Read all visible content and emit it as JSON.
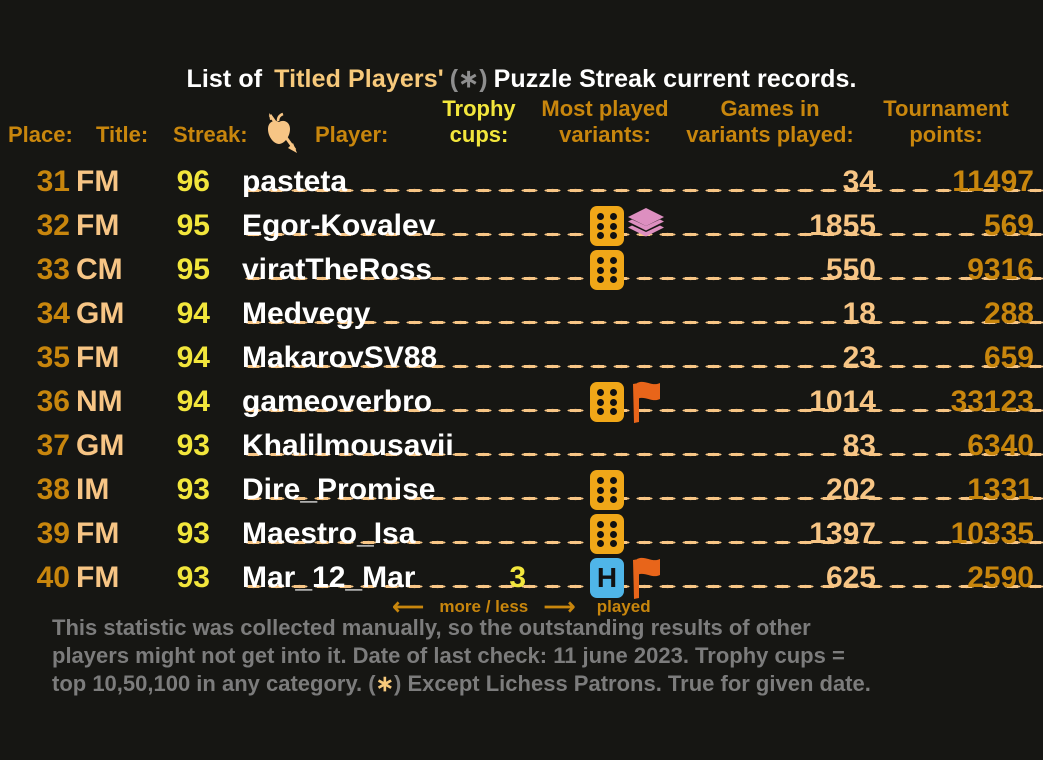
{
  "title": {
    "part1": "List of",
    "part2": "Titled Players'",
    "asterisk": "(∗)",
    "part3": "Puzzle Streak current records."
  },
  "headers": {
    "place": "Place:",
    "title": "Title:",
    "streak": "Streak:",
    "streak_icon": "apple-arrow-icon",
    "player": "Player:",
    "trophy_l1": "Trophy",
    "trophy_l2": "cups:",
    "most_l1": "Most played",
    "most_l2": "variants:",
    "games_l1": "Games in",
    "games_l2": "variants played:",
    "tourn_l1": "Tournament",
    "tourn_l2": "points:"
  },
  "colors": {
    "background": "#161613",
    "place": "#C8860D",
    "title_col": "#F7C585",
    "streak": "#F2E63C",
    "player": "#FFFFFF",
    "games": "#F7C585",
    "tournament": "#C8860D",
    "footer": "#7C7C7C",
    "die": "#F0A718",
    "layers": "#DD8FC0",
    "flag": "#E8651A",
    "horde": "#4FB5E8"
  },
  "rows": [
    {
      "place": "31",
      "title": "FM",
      "streak": "96",
      "player": "pasteta",
      "cups": "",
      "icons": [],
      "games": "34",
      "points": "11497"
    },
    {
      "place": "32",
      "title": "FM",
      "streak": "95",
      "player": "Egor-Kovalev",
      "cups": "",
      "icons": [
        "die",
        "layers"
      ],
      "games": "1855",
      "points": "569"
    },
    {
      "place": "33",
      "title": "CM",
      "streak": "95",
      "player": "viratTheRoss",
      "cups": "",
      "icons": [
        "die"
      ],
      "games": "550",
      "points": "9316"
    },
    {
      "place": "34",
      "title": "GM",
      "streak": "94",
      "player": "Medvegy",
      "cups": "",
      "icons": [],
      "games": "18",
      "points": "288"
    },
    {
      "place": "35",
      "title": "FM",
      "streak": "94",
      "player": "MakarovSV88",
      "cups": "",
      "icons": [],
      "games": "23",
      "points": "659"
    },
    {
      "place": "36",
      "title": "NM",
      "streak": "94",
      "player": "gameoverbro",
      "cups": "",
      "icons": [
        "die",
        "flag"
      ],
      "games": "1014",
      "points": "33123"
    },
    {
      "place": "37",
      "title": "GM",
      "streak": "93",
      "player": "Khalilmousavii",
      "cups": "",
      "icons": [],
      "games": "83",
      "points": "6340"
    },
    {
      "place": "38",
      "title": "IM",
      "streak": "93",
      "player": "Dire_Promise",
      "cups": "",
      "icons": [
        "die"
      ],
      "games": "202",
      "points": "1331"
    },
    {
      "place": "39",
      "title": "FM",
      "streak": "93",
      "player": "Maestro_Isa",
      "cups": "",
      "icons": [
        "die"
      ],
      "games": "1397",
      "points": "10335"
    },
    {
      "place": "40",
      "title": "FM",
      "streak": "93",
      "player": "Mar_12_Mar",
      "cups": "3",
      "icons": [
        "horde",
        "flag"
      ],
      "games": "625",
      "points": "2590"
    }
  ],
  "legend": {
    "arrow_left": "⟵",
    "more_less": "more / less",
    "arrow_right": "⟶",
    "played": "played"
  },
  "footer": {
    "line1": "This statistic was collected manually, so the outstanding results of other",
    "line2a": "players might not get into it. Date of last check: 11 june 2023. Trophy cups =",
    "line3a": "top 10,50,100 in any category. (",
    "line3_star": "∗",
    "line3b": ") Except Lichess Patrons. True for given date."
  }
}
